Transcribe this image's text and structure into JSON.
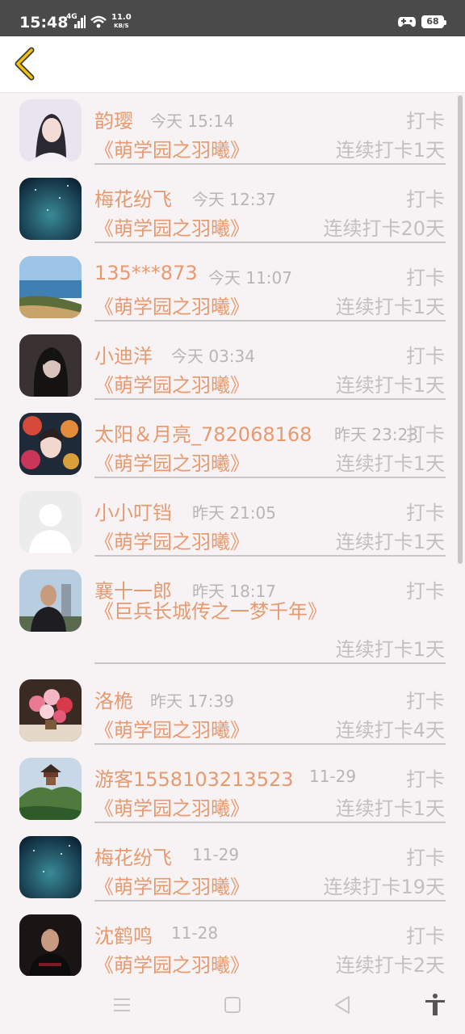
{
  "status_bar": {
    "time": "15:48",
    "network": "4G",
    "speed_value": "11.0",
    "speed_unit": "KB/S",
    "battery": "68"
  },
  "rows": [
    {
      "name": "韵璎",
      "time": "今天 15:14",
      "action": "打卡",
      "book": "《萌学园之羽曦》",
      "streak": "连续打卡1天",
      "avatar": "girl-portrait"
    },
    {
      "name": "梅花纷飞",
      "time": "今天 12:37",
      "action": "打卡",
      "book": "《萌学园之羽曦》",
      "streak": "连续打卡20天",
      "avatar": "starry-sky"
    },
    {
      "name": "135***873",
      "time": "今天 11:07",
      "action": "打卡",
      "book": "《萌学园之羽曦》",
      "streak": "连续打卡1天",
      "avatar": "seaside"
    },
    {
      "name": "小迪洋",
      "time": "今天 03:34",
      "action": "打卡",
      "book": "《萌学园之羽曦》",
      "streak": "连续打卡1天",
      "avatar": "dark-portrait"
    },
    {
      "name": "太阳＆月亮_782068168",
      "time": "昨天 23:23",
      "action": "打卡",
      "book": "《萌学园之羽曦》",
      "streak": "连续打卡1天",
      "avatar": "flower-girl"
    },
    {
      "name": "小小叮铛",
      "time": "昨天 21:05",
      "action": "打卡",
      "book": "《萌学园之羽曦》",
      "streak": "连续打卡1天",
      "avatar": "default-user"
    },
    {
      "name": "襄十一郎",
      "time": "昨天 18:17",
      "action": "打卡",
      "book": "《巨兵长城传之一梦千年》",
      "streak": "连续打卡1天",
      "avatar": "man-outdoor"
    },
    {
      "name": "洛桅",
      "time": "昨天 17:39",
      "action": "打卡",
      "book": "《萌学园之羽曦》",
      "streak": "连续打卡4天",
      "avatar": "flowers"
    },
    {
      "name": "游客1558103213523",
      "time": "11-29",
      "action": "打卡",
      "book": "《萌学园之羽曦》",
      "streak": "连续打卡1天",
      "avatar": "pavilion"
    },
    {
      "name": "梅花纷飞",
      "time": "11-29",
      "action": "打卡",
      "book": "《萌学园之羽曦》",
      "streak": "连续打卡19天",
      "avatar": "starry-sky"
    },
    {
      "name": "沈鹤鸣",
      "time": "11-28",
      "action": "打卡",
      "book": "《萌学园之羽曦》",
      "streak": "连续打卡2天",
      "avatar": "young-man"
    }
  ],
  "colors": {
    "accent": "#e79a70",
    "muted": "#c3bfc0",
    "back_icon": "#f2c400"
  }
}
